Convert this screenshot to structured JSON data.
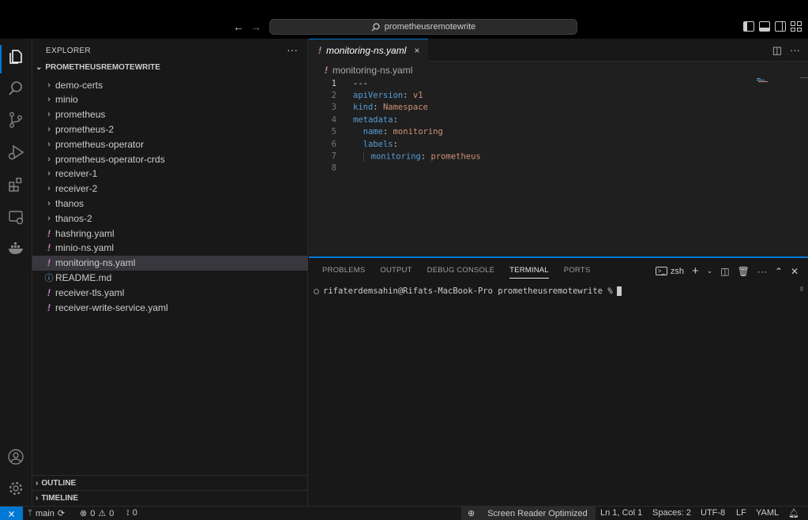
{
  "titlebar": {
    "back_label": "←",
    "forward_label": "→",
    "search_text": "prometheusremotewrite"
  },
  "activity": {
    "items": [
      "explorer",
      "search",
      "source-control",
      "run-debug",
      "extensions",
      "remote-explorer",
      "docker"
    ],
    "accent": "#0078d4"
  },
  "explorer": {
    "title": "EXPLORER",
    "more_label": "···",
    "root": "PROMETHEUSREMOTEWRITE",
    "items": [
      {
        "label": "demo-certs",
        "kind": "folder"
      },
      {
        "label": "minio",
        "kind": "folder"
      },
      {
        "label": "prometheus",
        "kind": "folder"
      },
      {
        "label": "prometheus-2",
        "kind": "folder"
      },
      {
        "label": "prometheus-operator",
        "kind": "folder"
      },
      {
        "label": "prometheus-operator-crds",
        "kind": "folder"
      },
      {
        "label": "receiver-1",
        "kind": "folder"
      },
      {
        "label": "receiver-2",
        "kind": "folder"
      },
      {
        "label": "thanos",
        "kind": "folder"
      },
      {
        "label": "thanos-2",
        "kind": "folder"
      },
      {
        "label": "hashring.yaml",
        "kind": "yaml"
      },
      {
        "label": "minio-ns.yaml",
        "kind": "yaml"
      },
      {
        "label": "monitoring-ns.yaml",
        "kind": "yaml",
        "selected": true
      },
      {
        "label": "README.md",
        "kind": "info"
      },
      {
        "label": "receiver-tls.yaml",
        "kind": "yaml"
      },
      {
        "label": "receiver-write-service.yaml",
        "kind": "yaml"
      }
    ],
    "outline_label": "OUTLINE",
    "timeline_label": "TIMELINE"
  },
  "editor": {
    "tab_label": "monitoring-ns.yaml",
    "tab_close": "×",
    "breadcrumb": "monitoring-ns.yaml",
    "lines": [
      {
        "n": "1",
        "key": "---",
        "sep": "",
        "val": "",
        "indent": 0
      },
      {
        "n": "2",
        "key": "apiVersion",
        "sep": ":",
        "val": "v1",
        "indent": 0
      },
      {
        "n": "3",
        "key": "kind",
        "sep": ":",
        "val": "Namespace",
        "indent": 0
      },
      {
        "n": "4",
        "key": "metadata",
        "sep": ":",
        "val": "",
        "indent": 0
      },
      {
        "n": "5",
        "key": "name",
        "sep": ":",
        "val": "monitoring",
        "indent": 1
      },
      {
        "n": "6",
        "key": "labels",
        "sep": ":",
        "val": "",
        "indent": 1
      },
      {
        "n": "7",
        "key": "monitoring",
        "sep": ":",
        "val": "prometheus",
        "indent": 2
      },
      {
        "n": "8",
        "key": "",
        "sep": "",
        "val": "",
        "indent": 0
      }
    ]
  },
  "panel": {
    "tabs": [
      "PROBLEMS",
      "OUTPUT",
      "DEBUG CONSOLE",
      "TERMINAL",
      "PORTS"
    ],
    "active_tab": "TERMINAL",
    "shell_label": "zsh",
    "terminal_prompt": "rifaterdemsahin@Rifats-MacBook-Pro prometheusremotewrite %"
  },
  "statusbar": {
    "branch": "main",
    "errors": "0",
    "warnings": "0",
    "ports": "0",
    "screen_reader": "Screen Reader Optimized",
    "position": "Ln 1, Col 1",
    "spaces": "Spaces: 2",
    "encoding": "UTF-8",
    "eol": "LF",
    "language": "YAML"
  }
}
